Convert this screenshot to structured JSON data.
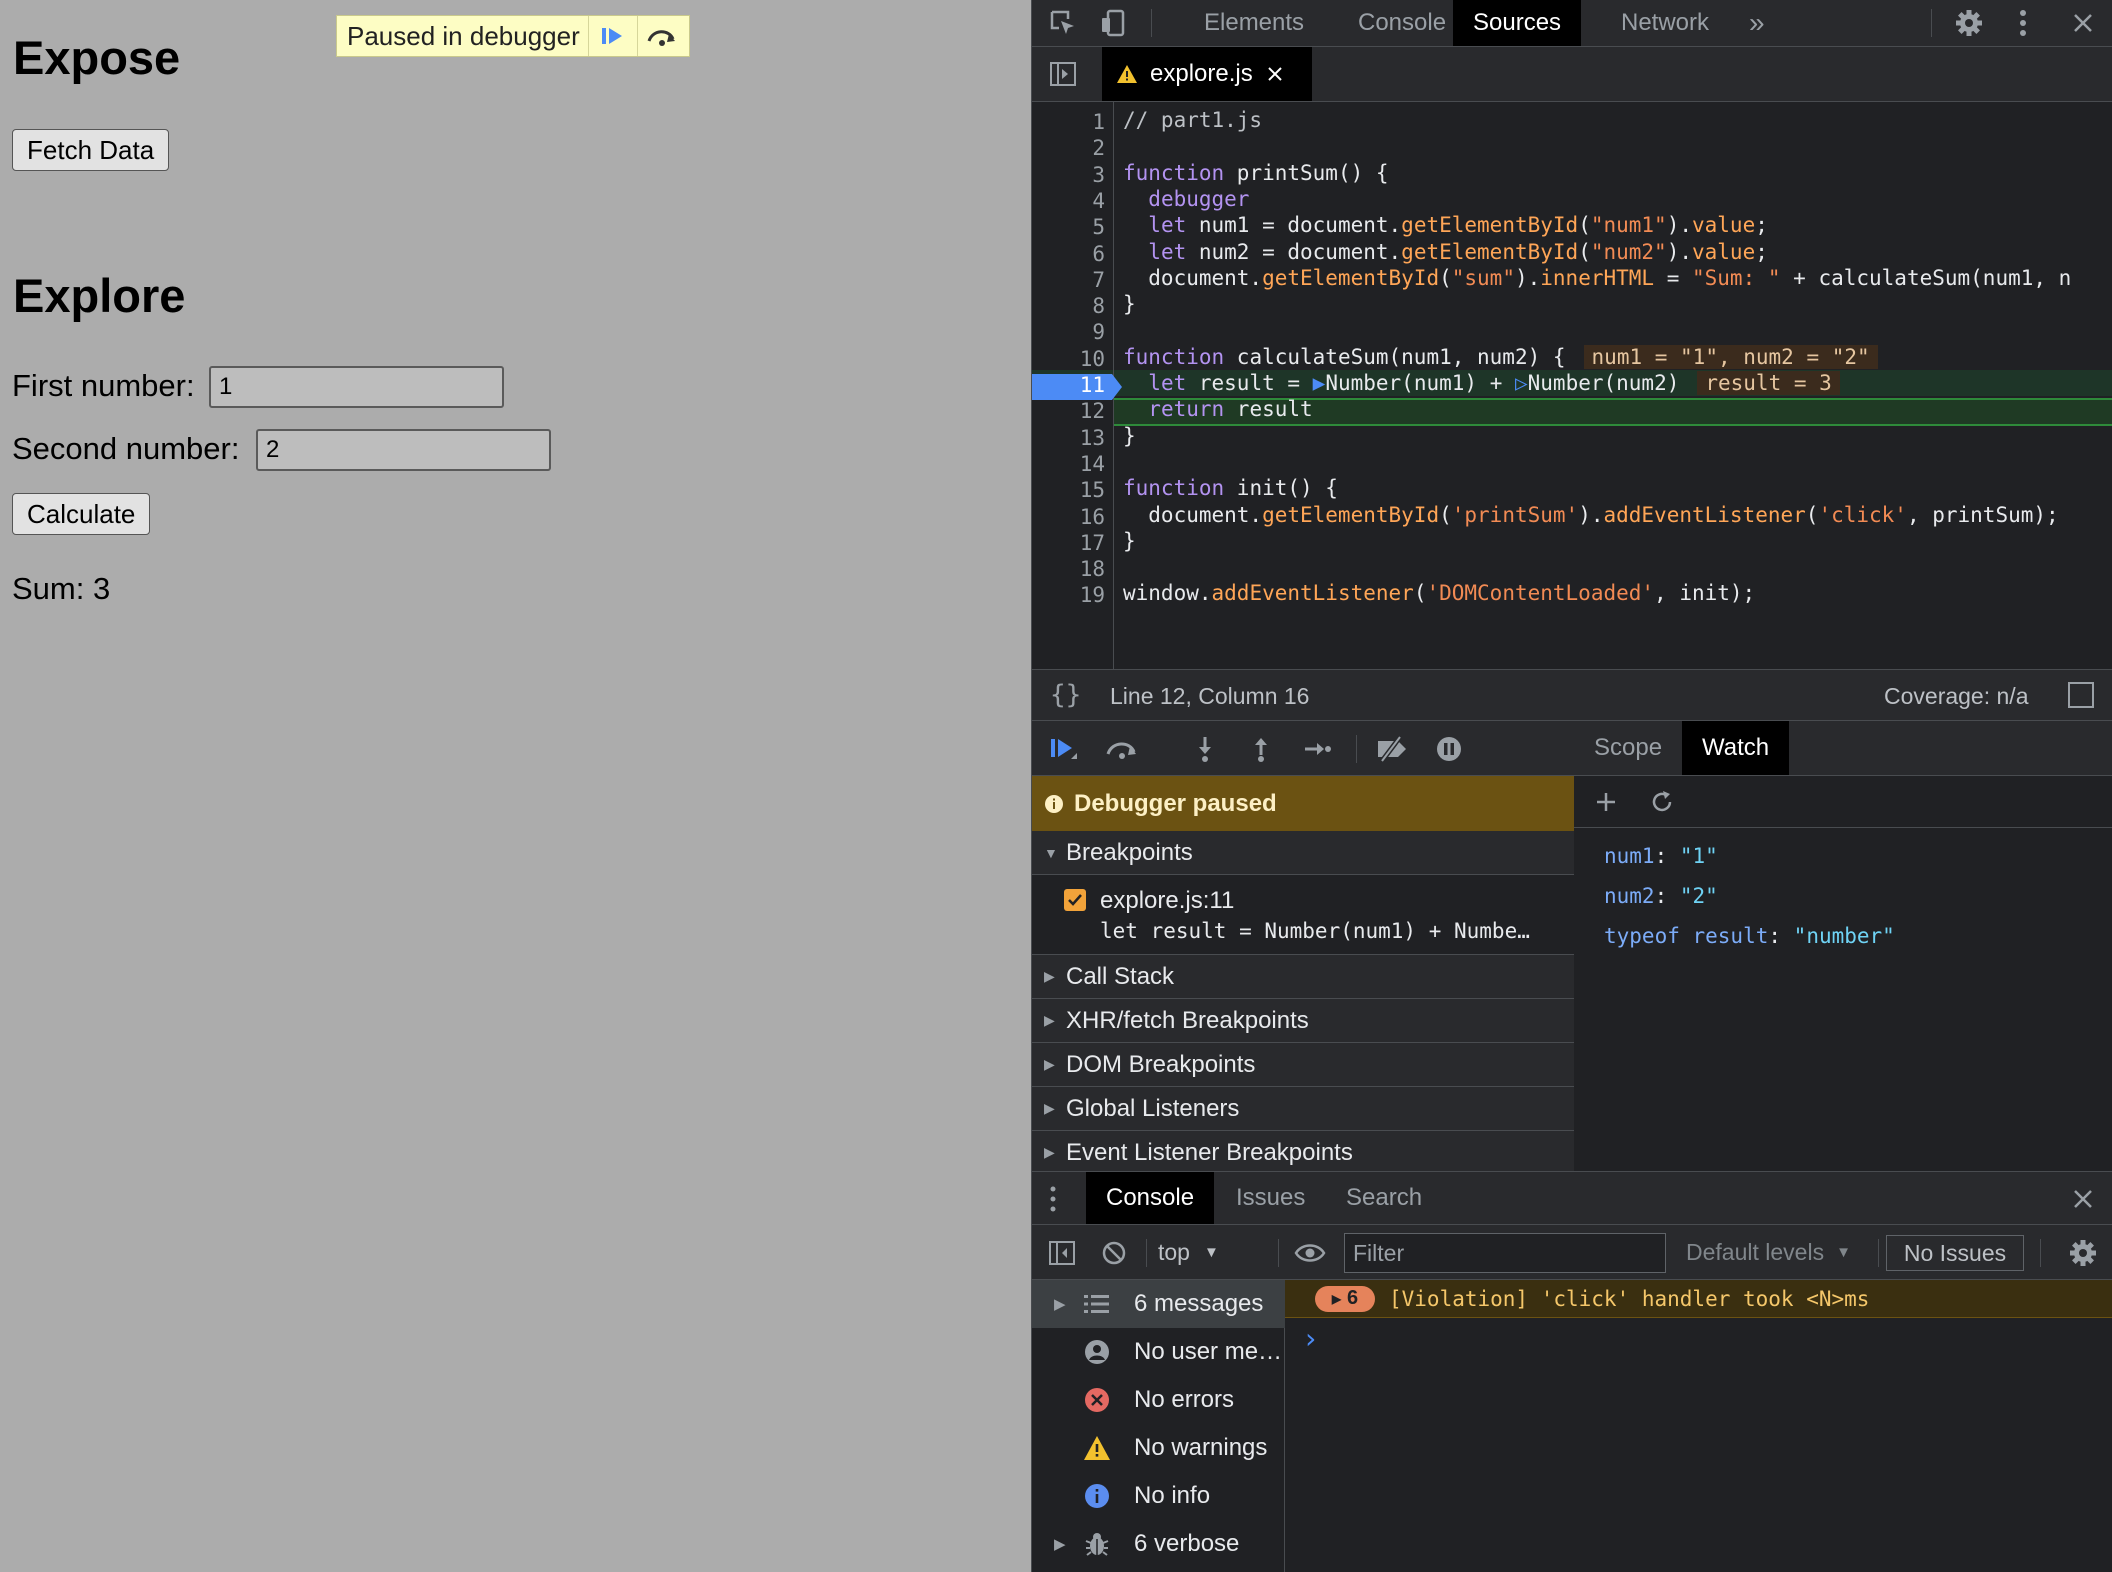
{
  "page": {
    "expose_heading": "Expose",
    "fetch_button": "Fetch Data",
    "explore_heading": "Explore",
    "first_label": "First number:",
    "first_value": "1",
    "second_label": "Second number:",
    "second_value": "2",
    "calculate_button": "Calculate",
    "sum_text": "Sum: 3",
    "paused_overlay": "Paused in debugger"
  },
  "devtools": {
    "tabs": [
      "Elements",
      "Console",
      "Sources",
      "Network"
    ],
    "more_tabs": "»",
    "active_tab": "Sources",
    "open_file": "explore.js",
    "code_lines": [
      {
        "n": "1",
        "html": "<span class='cmt'>// part1.js</span>"
      },
      {
        "n": "2",
        "html": ""
      },
      {
        "n": "3",
        "html": "<span class='k'>function</span> printSum() {"
      },
      {
        "n": "4",
        "html": "  <span class='k'>debugger</span>"
      },
      {
        "n": "5",
        "html": "  <span class='k'>let</span> num1 = document.<span class='f'>getElementById</span>(<span class='s'>\"num1\"</span>).<span class='f'>value</span>;"
      },
      {
        "n": "6",
        "html": "  <span class='k'>let</span> num2 = document.<span class='f'>getElementById</span>(<span class='s'>\"num2\"</span>).<span class='f'>value</span>;"
      },
      {
        "n": "7",
        "html": "  document.<span class='f'>getElementById</span>(<span class='s'>\"sum\"</span>).<span class='f'>innerHTML</span> = <span class='s'>\"Sum: \"</span> + calculateSum(num1, n"
      },
      {
        "n": "8",
        "html": "}"
      },
      {
        "n": "9",
        "html": ""
      },
      {
        "n": "10",
        "html": "<span class='k'>function</span> calculateSum(num1, num2) {<span class='inl'>num1 = \"1\", num2 = \"2\"</span>"
      },
      {
        "n": "11",
        "html": "  <span class='k'>let</span> result = <span style='color:#4c8bf5'>▶</span>Number(num1) + <span style='color:#4c8bf5'>▷</span>Number(num2)<span class='inl'>result = 3</span>"
      },
      {
        "n": "12",
        "html": "  <span class='k'>return</span> result"
      },
      {
        "n": "13",
        "html": "}"
      },
      {
        "n": "14",
        "html": ""
      },
      {
        "n": "15",
        "html": "<span class='k'>function</span> init() {"
      },
      {
        "n": "16",
        "html": "  document.<span class='f'>getElementById</span>(<span class='s'>'printSum'</span>).<span class='f'>addEventListener</span>(<span class='s'>'click'</span>, printSum);"
      },
      {
        "n": "17",
        "html": "}"
      },
      {
        "n": "18",
        "html": ""
      },
      {
        "n": "19",
        "html": "window.<span class='f'>addEventListener</span>(<span class='s'>'DOMContentLoaded'</span>, init);"
      }
    ],
    "status": {
      "position": "Line 12, Column 16",
      "coverage": "Coverage: n/a"
    },
    "debugger_paused": "Debugger paused",
    "breakpoints_title": "Breakpoints",
    "breakpoint_file": "explore.js:11",
    "breakpoint_code": "let result = Number(num1) + Numbe…",
    "sections": [
      "Call Stack",
      "XHR/fetch Breakpoints",
      "DOM Breakpoints",
      "Global Listeners",
      "Event Listener Breakpoints"
    ],
    "scope_tab": "Scope",
    "watch_tab": "Watch",
    "watch": [
      {
        "key": "num1",
        "value": "\"1\""
      },
      {
        "key": "num2",
        "value": "\"2\""
      },
      {
        "key": "typeof result",
        "value": "\"number\""
      }
    ],
    "drawer_tabs": [
      "Console",
      "Issues",
      "Search"
    ],
    "context": "top",
    "filter_placeholder": "Filter",
    "levels": "Default levels",
    "no_issues": "No Issues",
    "console_sidebar": [
      {
        "label": "6 messages",
        "icon": "list-icon"
      },
      {
        "label": "No user me…",
        "icon": "user-icon"
      },
      {
        "label": "No errors",
        "icon": "error-icon"
      },
      {
        "label": "No warnings",
        "icon": "warning-icon"
      },
      {
        "label": "No info",
        "icon": "info-icon"
      },
      {
        "label": "6 verbose",
        "icon": "bug-icon"
      }
    ],
    "violation_count": "6",
    "violation_text": "[Violation] 'click' handler took <N>ms",
    "prompt": "›"
  },
  "colors": {
    "accent": "#4c8bf5",
    "paused_banner": "#6b5212",
    "exec_line": "#1f3a24",
    "warning": "#f5c76a"
  }
}
